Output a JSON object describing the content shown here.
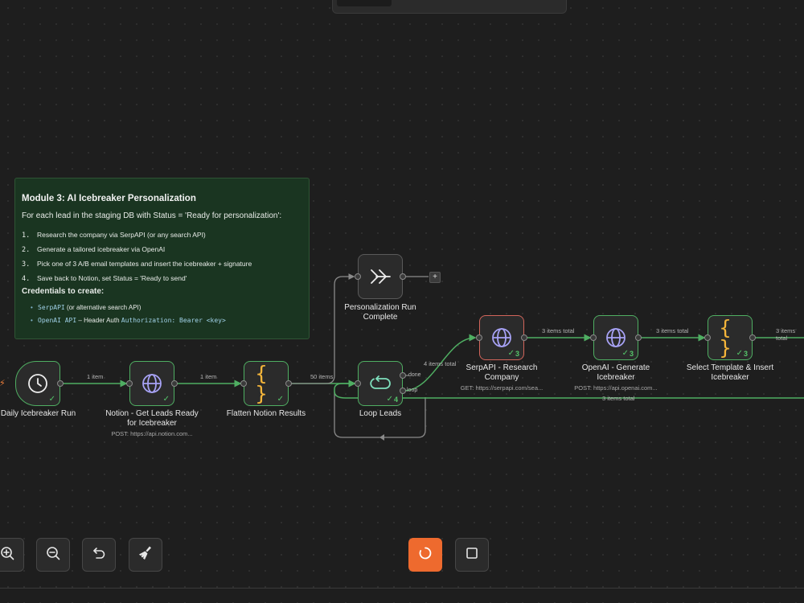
{
  "sticky_note": {
    "title": "Module 3: AI Icebreaker Personalization",
    "intro": "For each lead in the staging DB with Status = 'Ready for personalization':",
    "steps": [
      {
        "num": "1.",
        "text": "Research the company via SerpAPI (or any search API)"
      },
      {
        "num": "2.",
        "text": "Generate a tailored icebreaker via OpenAI"
      },
      {
        "num": "3.",
        "text": "Pick one of 3 A/B email templates and insert the icebreaker + signature"
      },
      {
        "num": "4.",
        "text": "Save back to Notion, set Status = 'Ready to send'"
      }
    ],
    "credentials_heading": "Credentials to create:",
    "credentials": [
      {
        "code": "SerpAPI",
        "text": " (or alternative search API)",
        "code2": ""
      },
      {
        "code": "OpenAI API",
        "text": " – Header Auth ",
        "code2": "Authorization: Bearer <key>"
      }
    ]
  },
  "nodes": {
    "trigger": {
      "label": "Daily Icebreaker Run",
      "icon": "clock-icon"
    },
    "notion": {
      "label": "Notion - Get Leads Ready for Icebreaker",
      "sub": "POST: https://api.notion.com...",
      "icon": "globe-icon"
    },
    "flatten": {
      "label": "Flatten Notion Results",
      "icon": "braces-icon"
    },
    "loop": {
      "label": "Loop Leads",
      "count": "4",
      "icon": "loop-icon",
      "out_done": "done",
      "out_loop": "loop"
    },
    "complete": {
      "label": "Personalization Run Complete",
      "icon": "double-chevron-icon"
    },
    "serpapi": {
      "label": "SerpAPI - Research Company",
      "sub": "GET: https://serpapi.com/sea...",
      "count": "3",
      "icon": "globe-icon"
    },
    "openai": {
      "label": "OpenAI - Generate Icebreaker",
      "sub": "POST: https://api.openai.com...",
      "count": "3",
      "icon": "globe-icon"
    },
    "template": {
      "label": "Select Template & Insert Icebreaker",
      "count": "3",
      "icon": "braces-icon"
    }
  },
  "edges": {
    "trigger_notion": "1 item",
    "notion_flatten": "1 item",
    "flatten_loop": "50 items",
    "loop_serpapi": "4 items total",
    "serpapi_openai": "3 items total",
    "openai_template": "3 items total",
    "template_next": "3 items total",
    "return_loop": "3 items total"
  },
  "braces_glyph": "{ }",
  "plus_glyph": "+",
  "check_glyph": "✓",
  "colors": {
    "success": "#4fae62",
    "error": "#d2655b",
    "accent": "#ee6a2e",
    "sticky_bg": "#1a3521",
    "canvas_bg": "#1e1e1e"
  },
  "toolbar": {
    "zoom_in": "zoom-in-icon",
    "zoom_out": "zoom-out-icon",
    "undo": "undo-icon",
    "clean": "broom-icon",
    "execute": "refresh-icon",
    "stop": "stop-icon"
  }
}
